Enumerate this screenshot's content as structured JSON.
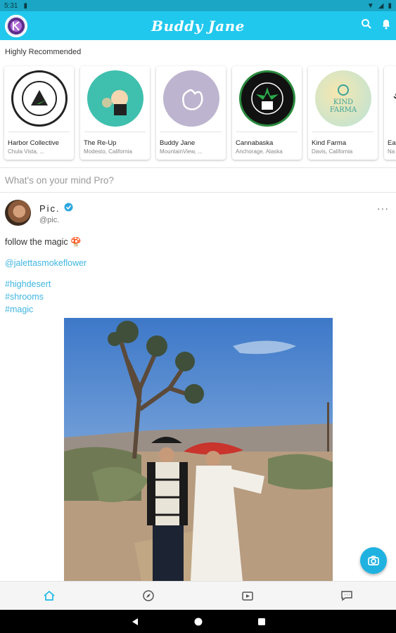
{
  "status": {
    "time": "5:31"
  },
  "app": {
    "title": "Buddy Jane"
  },
  "recommended": {
    "title": "Highly Recommended",
    "cards": [
      {
        "name": "Harbor Collective",
        "location": "Chula Vista, ..."
      },
      {
        "name": "The Re-Up",
        "location": "Modesto, California"
      },
      {
        "name": "Buddy Jane",
        "location": "MountainView, ..."
      },
      {
        "name": "Cannabaska",
        "location": "Anchorage, Alaska"
      },
      {
        "name": "Kind Farma",
        "location": "Davis, California"
      },
      {
        "name": "Ea",
        "location": "Na"
      }
    ]
  },
  "composer": {
    "placeholder": "What's on your mind Pro?"
  },
  "post": {
    "author": "Pic.",
    "handle": "@pic.",
    "more": "···",
    "text": "follow the magic 🍄",
    "mention": "@jalettasmokeflower",
    "tags": [
      "#highdesert",
      "#shrooms",
      "#magic"
    ]
  },
  "icons": {
    "status": [
      "sim-icon",
      "wifi-icon",
      "signal-icon",
      "battery-icon"
    ],
    "appbar": [
      "search-icon",
      "bell-icon"
    ],
    "bottomnav": [
      "home-icon",
      "compass-icon",
      "video-icon",
      "chat-icon"
    ],
    "sysnav": [
      "back-icon",
      "home-circle-icon",
      "recents-icon"
    ]
  },
  "colors": {
    "primary": "#21c8ee",
    "link": "#3fb6e0",
    "fab": "#1fb2e0"
  }
}
